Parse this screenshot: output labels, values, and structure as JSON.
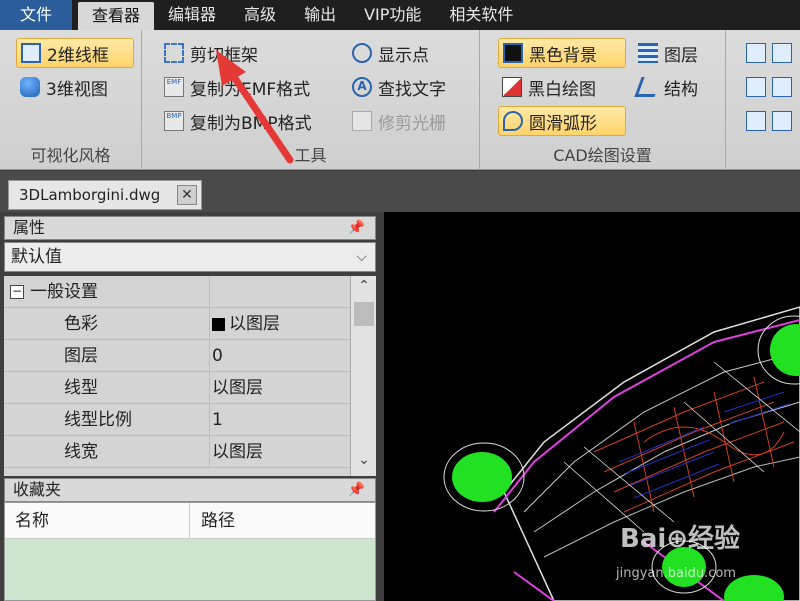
{
  "menubar": {
    "items": [
      "文件",
      "查看器",
      "编辑器",
      "高级",
      "输出",
      "VIP功能",
      "相关软件"
    ],
    "active": "查看器"
  },
  "ribbon": {
    "groups": [
      {
        "label": "可视化风格",
        "buttons": [
          "2维线框",
          "3维视图"
        ]
      },
      {
        "label": "工具",
        "buttons": [
          "剪切框架",
          "复制为EMF格式",
          "复制为BMP格式",
          "显示点",
          "查找文字",
          "修剪光栅"
        ]
      },
      {
        "label": "CAD绘图设置",
        "buttons": [
          "黑色背景",
          "黑白绘图",
          "圆滑弧形",
          "图层",
          "结构"
        ]
      }
    ]
  },
  "document_tab": {
    "title": "3DLamborgini.dwg",
    "close_glyph": "✕"
  },
  "properties": {
    "title": "属性",
    "dropdown_value": "默认值",
    "section": "一般设置",
    "rows": [
      {
        "key": "色彩",
        "value": "以图层"
      },
      {
        "key": "图层",
        "value": "0"
      },
      {
        "key": "线型",
        "value": "以图层"
      },
      {
        "key": "线型比例",
        "value": "1"
      },
      {
        "key": "线宽",
        "value": "以图层"
      }
    ]
  },
  "favorites": {
    "title": "收藏夹",
    "columns": [
      "名称",
      "路径"
    ]
  },
  "watermark": {
    "brand": "Bai⊕经验",
    "url": "jingyan.baidu.com"
  },
  "colors": {
    "accent": "#2b5d9b",
    "highlight": "#ffd36a",
    "arrow": "#e53935",
    "wheel": "#22e022"
  },
  "icons": [
    "box-icon",
    "cylinder-icon",
    "crop-icon",
    "emf-icon",
    "bmp-icon",
    "show-points-icon",
    "find-text-icon",
    "raster-icon",
    "black-bg-icon",
    "bw-icon",
    "arc-icon",
    "layers-icon",
    "structure-icon",
    "pin-icon",
    "chevron-down-icon"
  ]
}
